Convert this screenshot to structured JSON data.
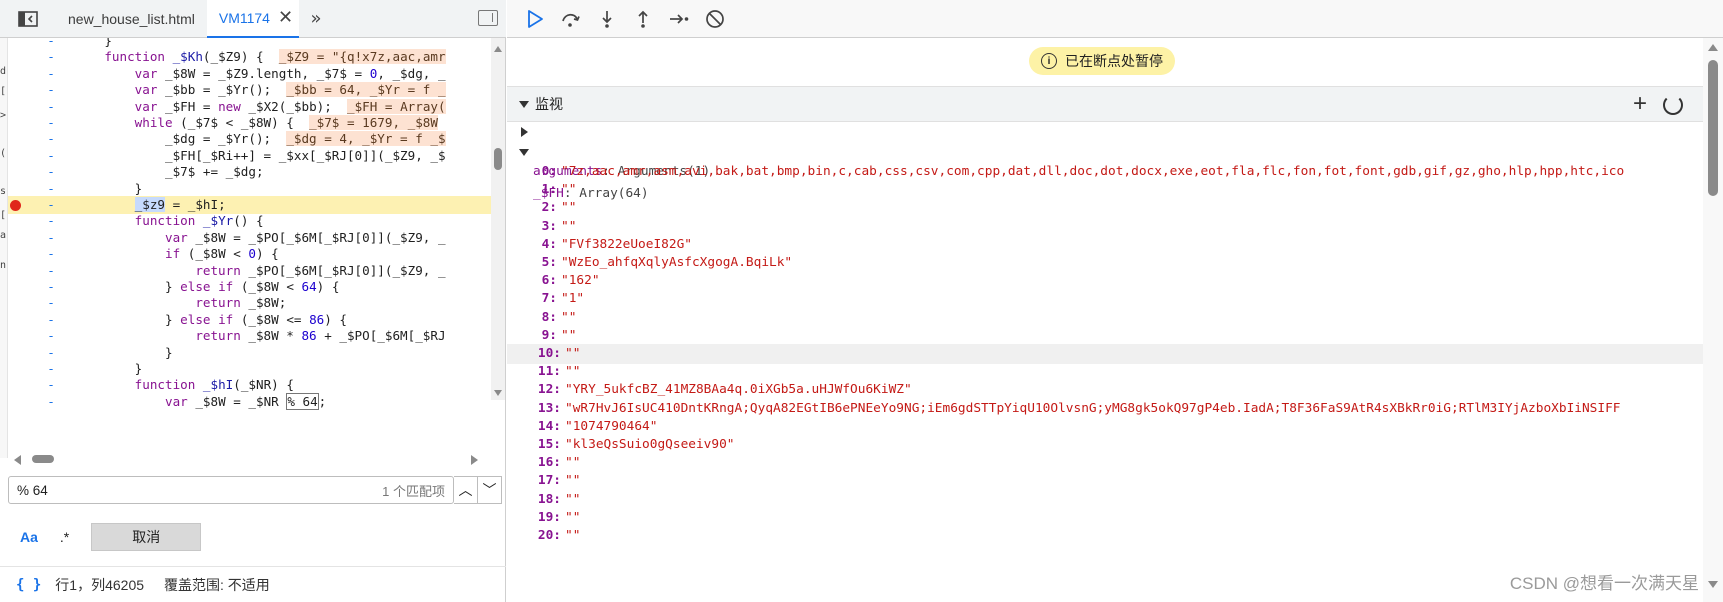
{
  "tabs": {
    "items": [
      {
        "label": "new_house_list.html"
      },
      {
        "label": "VM1174"
      }
    ]
  },
  "source": {
    "gutter_marks": [
      "d",
      "[",
      ">",
      "(",
      "s",
      "[",
      "a",
      "n"
    ],
    "lines": [
      {
        "ln": "-",
        "segs": [
          [
            "",
            "    }"
          ]
        ]
      },
      {
        "ln": "-",
        "segs": [
          [
            "kw",
            "    function "
          ],
          [
            "fn",
            "_$Kh"
          ],
          [
            "",
            "("
          ],
          [
            "",
            "_$Z9"
          ],
          [
            "",
            ") {  "
          ],
          [
            "inl",
            "_$Z9 = \"{q!x7z,aac,amr"
          ]
        ]
      },
      {
        "ln": "-",
        "segs": [
          [
            "kw",
            "        var "
          ],
          [
            "",
            "_$8W = _$Z9.length, _$7$ = "
          ],
          [
            "num",
            "0"
          ],
          [
            "",
            ", _$dg, _"
          ]
        ]
      },
      {
        "ln": "-",
        "segs": [
          [
            "kw",
            "        var "
          ],
          [
            "",
            "_$bb = _$Yr();  "
          ],
          [
            "inl",
            "_$bb = 64, _$Yr = f _"
          ]
        ]
      },
      {
        "ln": "-",
        "segs": [
          [
            "kw",
            "        var "
          ],
          [
            "",
            "_$FH = "
          ],
          [
            "kw",
            "new "
          ],
          [
            "",
            "_$X2(_$bb);  "
          ],
          [
            "inl",
            "_$FH = Array("
          ]
        ]
      },
      {
        "ln": "-",
        "segs": [
          [
            "kw",
            "        while "
          ],
          [
            "",
            "(_$7$ < _$8W) {  "
          ],
          [
            "inl",
            "_$7$ = 1679, _$8W"
          ]
        ]
      },
      {
        "ln": "-",
        "segs": [
          [
            "",
            "            _$dg = _$Yr();  "
          ],
          [
            "inl",
            "_$dg = 4, _$Yr = f _$"
          ]
        ]
      },
      {
        "ln": "-",
        "segs": [
          [
            "",
            "            _$FH[_$Ri++] = _$xx[_$RJ[0]](_$Z9, _$"
          ]
        ]
      },
      {
        "ln": "-",
        "segs": [
          [
            "",
            "            _$7$ += _$dg;"
          ]
        ]
      },
      {
        "ln": "-",
        "segs": [
          [
            "",
            "        }"
          ]
        ]
      },
      {
        "ln": "-",
        "bp": true,
        "segs": [
          [
            "",
            "        "
          ],
          [
            "sel",
            "_$z9"
          ],
          [
            "",
            " = _$hI;"
          ]
        ]
      },
      {
        "ln": "-",
        "segs": [
          [
            "kw",
            "        function "
          ],
          [
            "fn",
            "_$Yr"
          ],
          [
            "",
            "() {"
          ]
        ]
      },
      {
        "ln": "-",
        "segs": [
          [
            "kw",
            "            var "
          ],
          [
            "",
            "_$8W = _$PO[_$6M[_$RJ[0]](_$Z9, _"
          ]
        ]
      },
      {
        "ln": "-",
        "segs": [
          [
            "kw",
            "            if "
          ],
          [
            "",
            "(_$8W < "
          ],
          [
            "num",
            "0"
          ],
          [
            "",
            ") {"
          ]
        ]
      },
      {
        "ln": "-",
        "segs": [
          [
            "kw",
            "                return "
          ],
          [
            "",
            "_$PO[_$6M[_$RJ[0]](_$Z9, _"
          ]
        ]
      },
      {
        "ln": "-",
        "segs": [
          [
            "",
            "            } "
          ],
          [
            "kw",
            "else if "
          ],
          [
            "",
            "(_$8W < "
          ],
          [
            "num",
            "64"
          ],
          [
            "",
            ") {"
          ]
        ]
      },
      {
        "ln": "-",
        "segs": [
          [
            "kw",
            "                return "
          ],
          [
            "",
            "_$8W;"
          ]
        ]
      },
      {
        "ln": "-",
        "segs": [
          [
            "",
            "            } "
          ],
          [
            "kw",
            "else if "
          ],
          [
            "",
            "(_$8W <= "
          ],
          [
            "num",
            "86"
          ],
          [
            "",
            ") {"
          ]
        ]
      },
      {
        "ln": "-",
        "segs": [
          [
            "kw",
            "                return "
          ],
          [
            "",
            "_$8W * "
          ],
          [
            "num",
            "86"
          ],
          [
            "",
            " + _$PO[_$6M[_$RJ"
          ]
        ]
      },
      {
        "ln": "-",
        "segs": [
          [
            "",
            "            }"
          ]
        ]
      },
      {
        "ln": "-",
        "segs": [
          [
            "",
            "        }"
          ]
        ]
      },
      {
        "ln": "-",
        "segs": [
          [
            "kw",
            "        function "
          ],
          [
            "fn",
            "_$hI"
          ],
          [
            "",
            "(_$NR) {"
          ]
        ]
      },
      {
        "ln": "-",
        "segs": [
          [
            "kw",
            "            var "
          ],
          [
            "",
            "_$8W = _$NR "
          ],
          [
            "boxed",
            "% 64"
          ],
          [
            "",
            ";"
          ]
        ]
      }
    ]
  },
  "search": {
    "query": "% 64",
    "match_count": "1 个匹配项",
    "case_label": "Aa",
    "regex_label": ".*",
    "cancel_label": "取消"
  },
  "status": {
    "braces": "{ }",
    "position": "行1，列46205",
    "coverage": "覆盖范围: 不适用"
  },
  "debugger": {
    "paused_text": "已在断点处暂停",
    "watch_title": "监视"
  },
  "watch": {
    "arguments": {
      "key": "arguments",
      "value": "Arguments(1)"
    },
    "fh": {
      "key": "_$FH",
      "value": "Array(64)"
    },
    "items": [
      {
        "i": "0:",
        "v": "\"7z,aac,amr,asm,avi,bak,bat,bmp,bin,c,cab,css,csv,com,cpp,dat,dll,doc,dot,docx,exe,eot,fla,flc,fon,fot,font,gdb,gif,gz,gho,hlp,hpp,htc,ico"
      },
      {
        "i": "1:",
        "v": "\"\""
      },
      {
        "i": "2:",
        "v": "\"\""
      },
      {
        "i": "3:",
        "v": "\"\""
      },
      {
        "i": "4:",
        "v": "\"FVf3822eUoeI82G\""
      },
      {
        "i": "5:",
        "v": "\"WzEo_ahfqXqlyAsfcXgogA.BqiLk\""
      },
      {
        "i": "6:",
        "v": "\"162\""
      },
      {
        "i": "7:",
        "v": "\"1\""
      },
      {
        "i": "8:",
        "v": "\"\""
      },
      {
        "i": "9:",
        "v": "\"\""
      },
      {
        "i": "10:",
        "v": "\"\"",
        "hl": true
      },
      {
        "i": "11:",
        "v": "\"\""
      },
      {
        "i": "12:",
        "v": "\"YRY_5ukfcBZ_41MZ8BAa4q.0iXGb5a.uHJWfOu6KiWZ\""
      },
      {
        "i": "13:",
        "v": "\"wR7HvJ6IsUC410DntKRngA;QyqA82EGtIB6ePNEeYo9NG;iEm6gdSTTpYiqU10OlvsnG;yMG8gk5okQ97gP4eb.IadA;T8F36FaS9AtR4sXBkRr0iG;RTlM3IYjAzboXbIiNSIFF"
      },
      {
        "i": "14:",
        "v": "\"1074790464\""
      },
      {
        "i": "15:",
        "v": "\"kl3eQsSuio0gQseeiv90\""
      },
      {
        "i": "16:",
        "v": "\"\""
      },
      {
        "i": "17:",
        "v": "\"\""
      },
      {
        "i": "18:",
        "v": "\"\""
      },
      {
        "i": "19:",
        "v": "\"\""
      },
      {
        "i": "20:",
        "v": "\"\""
      }
    ]
  },
  "watermark": "CSDN @想看一次满天星",
  "icons": [
    "sidebar-toggle-icon",
    "close-icon",
    "more-tabs-icon",
    "collapse-panel-icon",
    "resume-icon",
    "step-over-icon",
    "step-into-icon",
    "step-out-icon",
    "step-icon",
    "deactivate-breakpoints-icon",
    "info-icon",
    "add-icon",
    "refresh-icon",
    "chevron-up-icon",
    "chevron-down-icon"
  ]
}
